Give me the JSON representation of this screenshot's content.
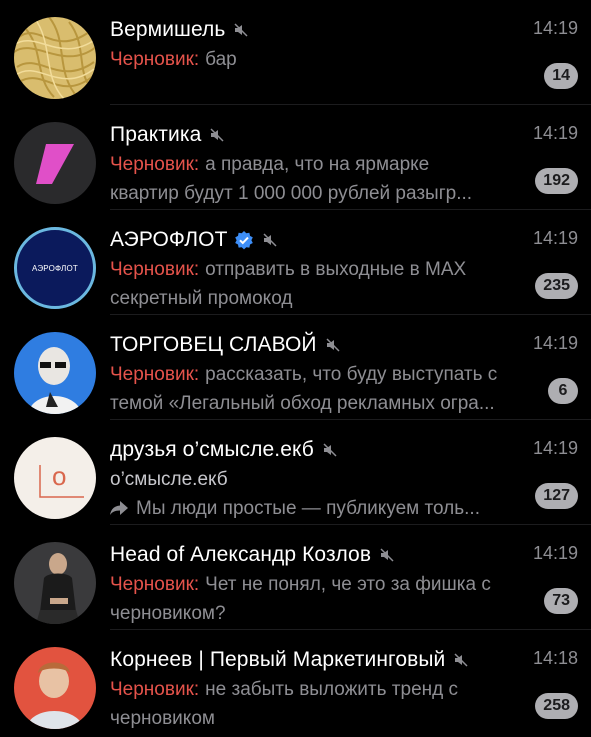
{
  "chats": [
    {
      "title": "Вермишель",
      "time": "14:19",
      "draft_label": "Черновик:",
      "lines": [
        "бар"
      ],
      "unread": "14",
      "muted": true,
      "verified": false
    },
    {
      "title": "Практика",
      "time": "14:19",
      "draft_label": "Черновик:",
      "lines": [
        "а правда, что на ярмарке",
        "квартир будут 1 000 000 рублей разыгр..."
      ],
      "unread": "192",
      "muted": true,
      "verified": false
    },
    {
      "title": "АЭРОФЛОТ",
      "time": "14:19",
      "draft_label": "Черновик:",
      "lines": [
        "отправить в выходные в MAX",
        "секретный промокод"
      ],
      "unread": "235",
      "muted": true,
      "verified": true,
      "avatar_text": "АЭРОФЛОТ"
    },
    {
      "title": "ТОРГОВЕЦ СЛАВОЙ",
      "time": "14:19",
      "draft_label": "Черновик:",
      "lines": [
        "рассказать, что буду выступать с",
        "темой «Легальный обход рекламных огра..."
      ],
      "unread": "6",
      "muted": true,
      "verified": false
    },
    {
      "title": "друзья о’смысле.екб",
      "time": "14:19",
      "sender": "о’смысле.екб",
      "lines": [
        "Мы люди простые — публикуем толь..."
      ],
      "forwarded": true,
      "unread": "127",
      "muted": true,
      "verified": false,
      "avatar_text": "о"
    },
    {
      "title": "Head of Александр Козлов",
      "time": "14:19",
      "draft_label": "Черновик:",
      "lines": [
        "Чет не понял, че это за фишка с",
        "черновиком?"
      ],
      "unread": "73",
      "muted": true,
      "verified": false
    },
    {
      "title": "Корнеев | Первый Маркетинговый",
      "time": "14:18",
      "draft_label": "Черновик:",
      "lines": [
        "не забыть выложить тренд с",
        "черновиком"
      ],
      "unread": "258",
      "muted": true,
      "verified": false
    }
  ],
  "colors": {
    "background": "#000000",
    "draft": "#e5534b",
    "secondary_text": "#8e8e93",
    "badge_muted": "#aeaeb2",
    "verified": "#3d8ef7"
  },
  "icons": {
    "mute": "speaker-muted-icon",
    "verified": "verified-check-icon",
    "forward": "forward-arrow-icon"
  }
}
